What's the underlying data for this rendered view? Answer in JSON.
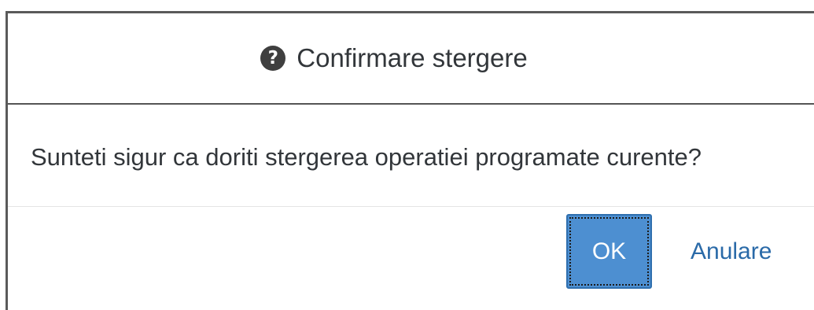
{
  "dialog": {
    "title": "Confirmare stergere",
    "icon": "question-circle-icon",
    "message": "Sunteti sigur ca doriti stergerea operatiei programate curente?",
    "buttons": {
      "ok_label": "OK",
      "cancel_label": "Anulare"
    },
    "colors": {
      "primary_button": "#4d8fd1",
      "link_text": "#2a6aa8",
      "text": "#32363a"
    }
  }
}
